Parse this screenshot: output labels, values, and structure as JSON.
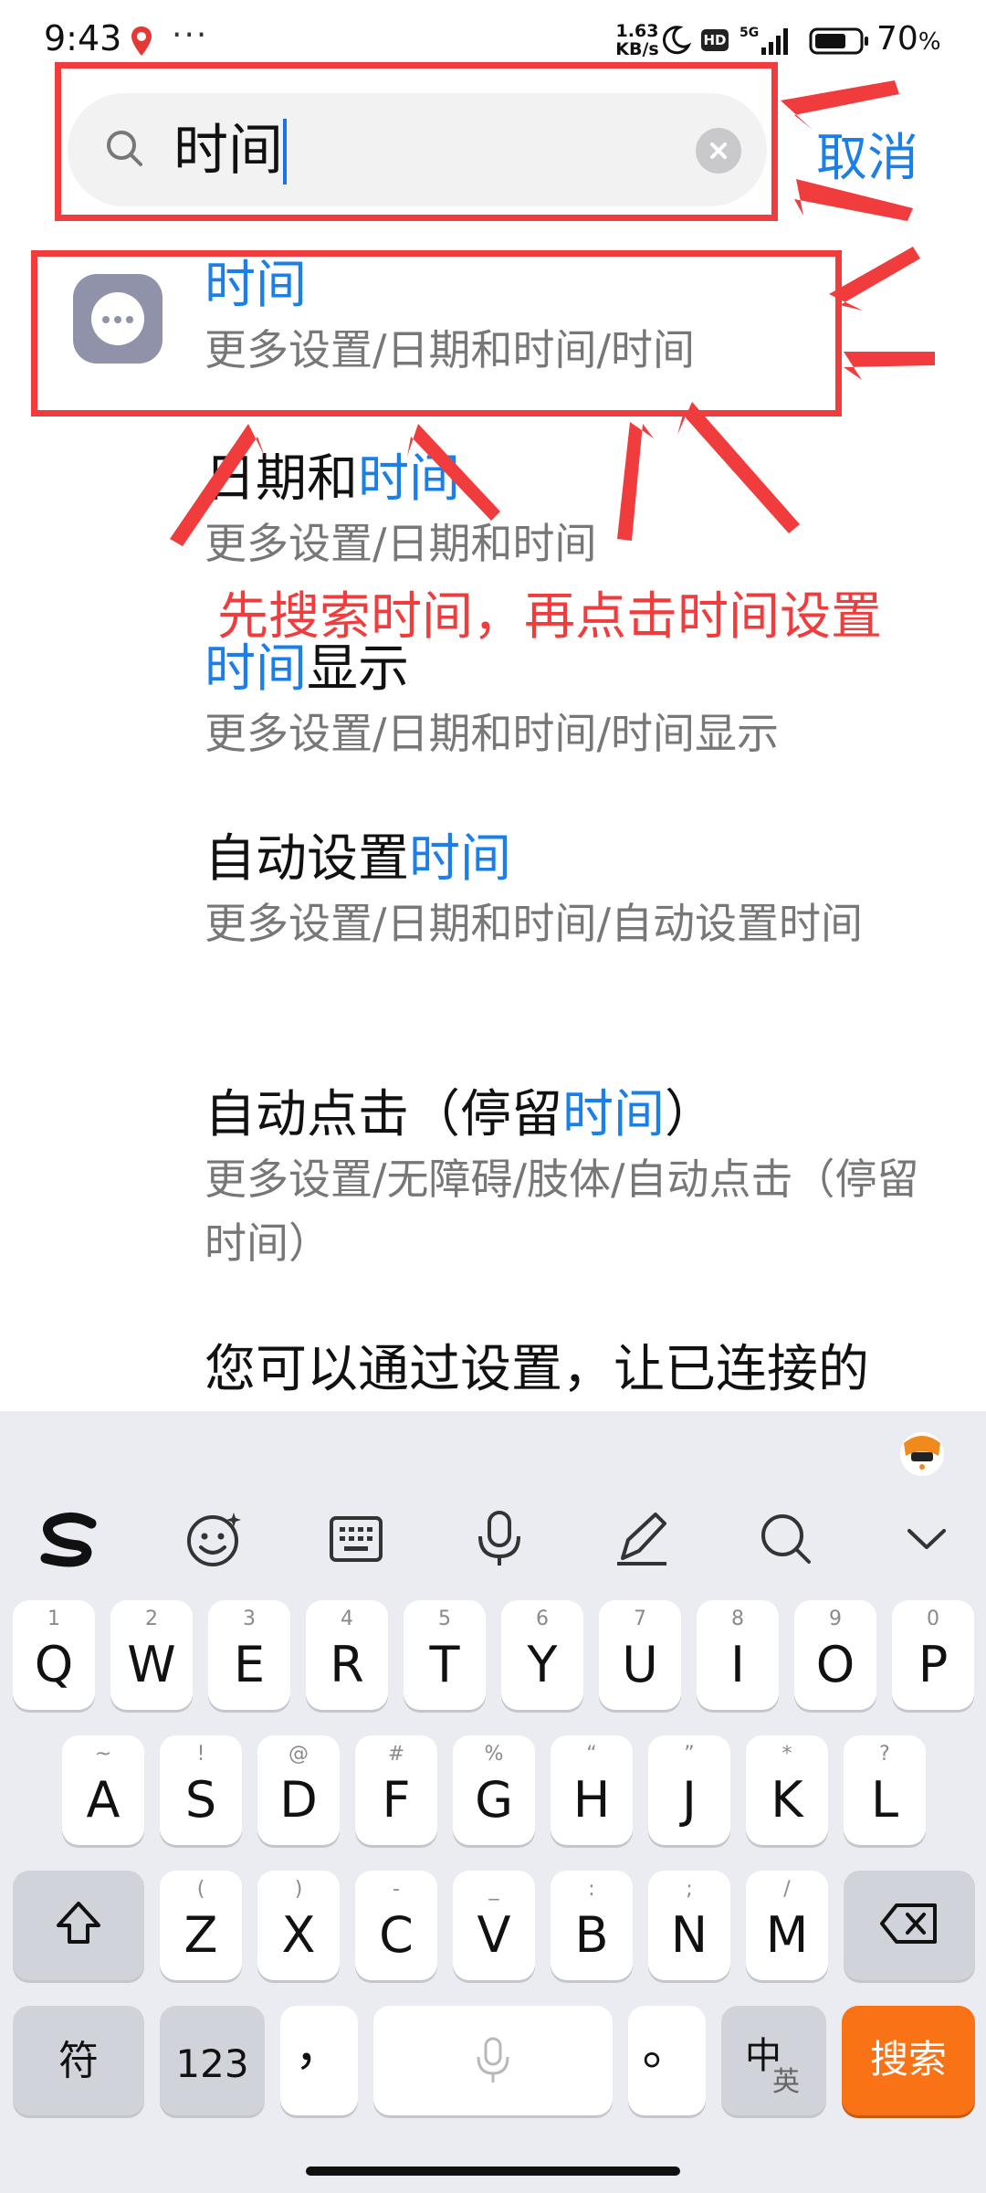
{
  "status_bar": {
    "time": "9:43",
    "dots": "···",
    "net_speed_value": "1.63",
    "net_speed_unit": "KB/s",
    "hd": "HD",
    "network": "5G",
    "battery": "70",
    "battery_unit": "%"
  },
  "search": {
    "value": "时间",
    "cancel_label": "取消"
  },
  "results": [
    {
      "title_pre": "",
      "title_hl": "时间",
      "title_post": "",
      "path": "更多设置/日期和时间/时间"
    },
    {
      "title_pre": "日期和",
      "title_hl": "时间",
      "title_post": "",
      "path": "更多设置/日期和时间"
    },
    {
      "title_pre": "",
      "title_hl": "时间",
      "title_post": "显示",
      "path": "更多设置/日期和时间/时间显示"
    },
    {
      "title_pre": "自动设置",
      "title_hl": "时间",
      "title_post": "",
      "path": "更多设置/日期和时间/自动设置时间"
    },
    {
      "title_pre": "自动点击（停留",
      "title_hl": "时间",
      "title_post": "）",
      "path": "更多设置/无障碍/肢体/自动点击（停留时间）"
    },
    {
      "title_pre": "您可以通过设置，让已连接的",
      "title_hl": "",
      "title_post": "",
      "path": ""
    }
  ],
  "annotation": {
    "note": "先搜索时间，再点击时间设置",
    "color": "#f03c3c"
  },
  "keyboard": {
    "toolbar_icons": [
      "sogou-logo-icon",
      "emoji-icon",
      "keyboard-icon",
      "microphone-icon",
      "handwriting-icon",
      "search-icon",
      "chevron-down-icon"
    ],
    "row1": [
      {
        "main": "Q",
        "sub": "1"
      },
      {
        "main": "W",
        "sub": "2"
      },
      {
        "main": "E",
        "sub": "3"
      },
      {
        "main": "R",
        "sub": "4"
      },
      {
        "main": "T",
        "sub": "5"
      },
      {
        "main": "Y",
        "sub": "6"
      },
      {
        "main": "U",
        "sub": "7"
      },
      {
        "main": "I",
        "sub": "8"
      },
      {
        "main": "O",
        "sub": "9"
      },
      {
        "main": "P",
        "sub": "0"
      }
    ],
    "row2": [
      {
        "main": "A",
        "sub": "~"
      },
      {
        "main": "S",
        "sub": "!"
      },
      {
        "main": "D",
        "sub": "@"
      },
      {
        "main": "F",
        "sub": "#"
      },
      {
        "main": "G",
        "sub": "%"
      },
      {
        "main": "H",
        "sub": "“"
      },
      {
        "main": "J",
        "sub": "”"
      },
      {
        "main": "K",
        "sub": "*"
      },
      {
        "main": "L",
        "sub": "?"
      }
    ],
    "row3": [
      {
        "main": "Z",
        "sub": "("
      },
      {
        "main": "X",
        "sub": ")"
      },
      {
        "main": "C",
        "sub": "-"
      },
      {
        "main": "V",
        "sub": "_"
      },
      {
        "main": "B",
        "sub": ":"
      },
      {
        "main": "N",
        "sub": ";"
      },
      {
        "main": "M",
        "sub": "/"
      }
    ],
    "symbol_label": "符",
    "numbers_label": "123",
    "comma_label": "，",
    "period_label": "。",
    "lang_main": "中",
    "lang_sub": "英",
    "search_label": "搜索",
    "search_color": "#f97316"
  }
}
